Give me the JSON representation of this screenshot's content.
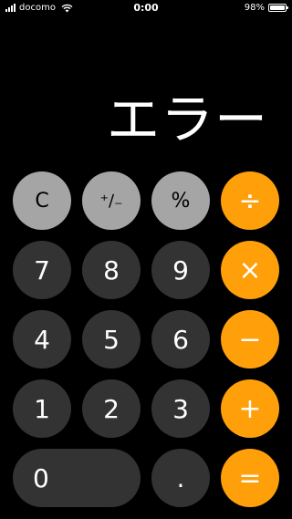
{
  "status_bar": {
    "carrier": "docomo",
    "time": "0:00",
    "battery_percent": "98%",
    "battery_level": 0.98,
    "icons": [
      "signal-icon",
      "wifi-icon",
      "battery-icon"
    ]
  },
  "display": {
    "value": "エラー"
  },
  "keys": {
    "clear": "C",
    "plus_minus": "⁺∕₋",
    "percent": "%",
    "divide": "÷",
    "seven": "7",
    "eight": "8",
    "nine": "9",
    "multiply": "×",
    "four": "4",
    "five": "5",
    "six": "6",
    "minus": "−",
    "one": "1",
    "two": "2",
    "three": "3",
    "plus": "+",
    "zero": "0",
    "decimal": ".",
    "equals": "="
  },
  "colors": {
    "background": "#000000",
    "function_key": "#a5a5a5",
    "number_key": "#333333",
    "operator_key": "#ff9f0a"
  }
}
